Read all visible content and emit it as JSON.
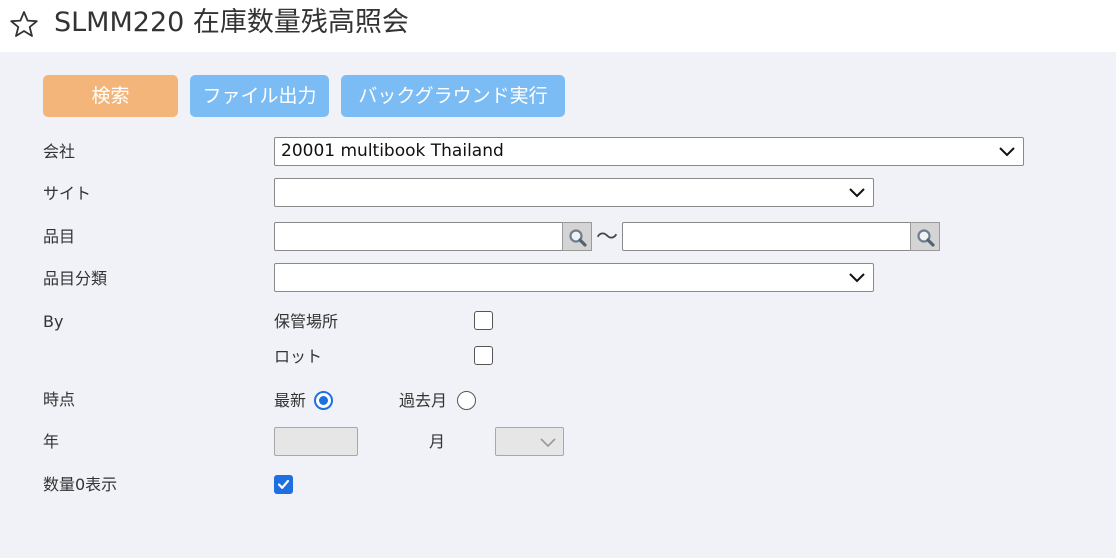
{
  "header": {
    "title": "SLMM220 在庫数量残高照会",
    "favorite_icon": "star-outline-icon"
  },
  "toolbar": {
    "search_label": "検索",
    "file_output_label": "ファイル出力",
    "background_run_label": "バックグラウンド実行",
    "search_color": "#f4b57a",
    "secondary_color": "#7cbcf5"
  },
  "form": {
    "company": {
      "label": "会社",
      "value": "20001 multibook Thailand"
    },
    "site": {
      "label": "サイト",
      "value": ""
    },
    "item": {
      "label": "品目",
      "from_value": "",
      "to_value": "",
      "range_separator": "〜"
    },
    "item_category": {
      "label": "品目分類",
      "value": ""
    },
    "by": {
      "label": "By",
      "options": [
        {
          "label": "保管場所",
          "checked": false
        },
        {
          "label": "ロット",
          "checked": false
        }
      ]
    },
    "point_in_time": {
      "label": "時点",
      "options": [
        {
          "label": "最新",
          "selected": true
        },
        {
          "label": "過去月",
          "selected": false
        }
      ]
    },
    "year": {
      "label": "年",
      "value": ""
    },
    "month": {
      "label": "月",
      "value": ""
    },
    "show_zero_qty": {
      "label": "数量0表示",
      "checked": true
    }
  },
  "accent_color": "#1e6fe0"
}
